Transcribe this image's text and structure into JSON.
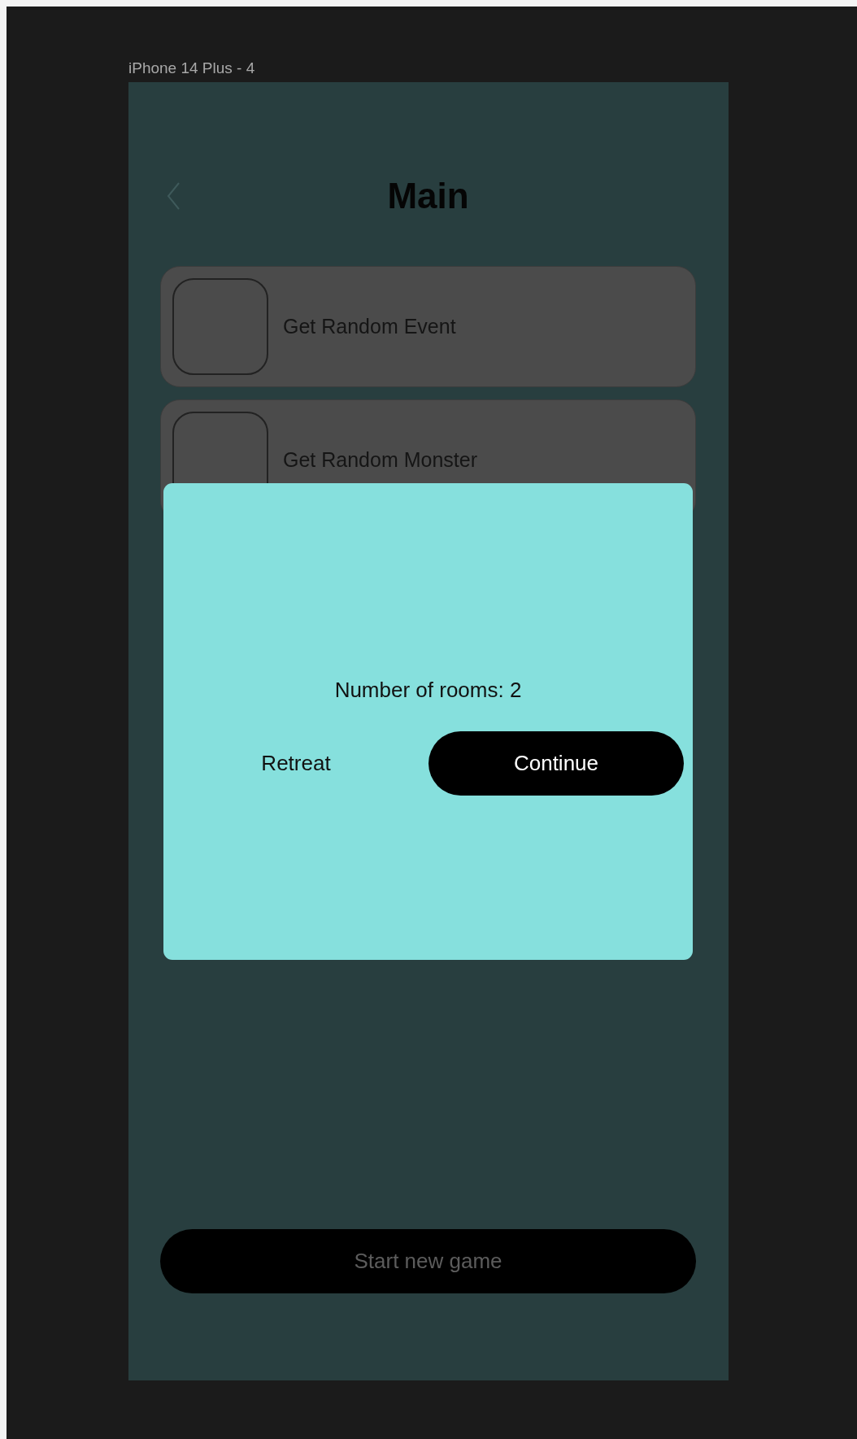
{
  "canvas_label": "iPhone 14 Plus - 4",
  "screen": {
    "title": "Main",
    "menu_items": [
      {
        "label": "Get Random Event"
      },
      {
        "label": "Get Random Monster"
      }
    ],
    "primary_button": {
      "label": "Start new game",
      "disabled": true
    }
  },
  "dialog": {
    "message": "Number of rooms: 2",
    "buttons": [
      {
        "label": "Retreat",
        "kind": "text"
      },
      {
        "label": "Continue",
        "kind": "filled"
      }
    ]
  }
}
